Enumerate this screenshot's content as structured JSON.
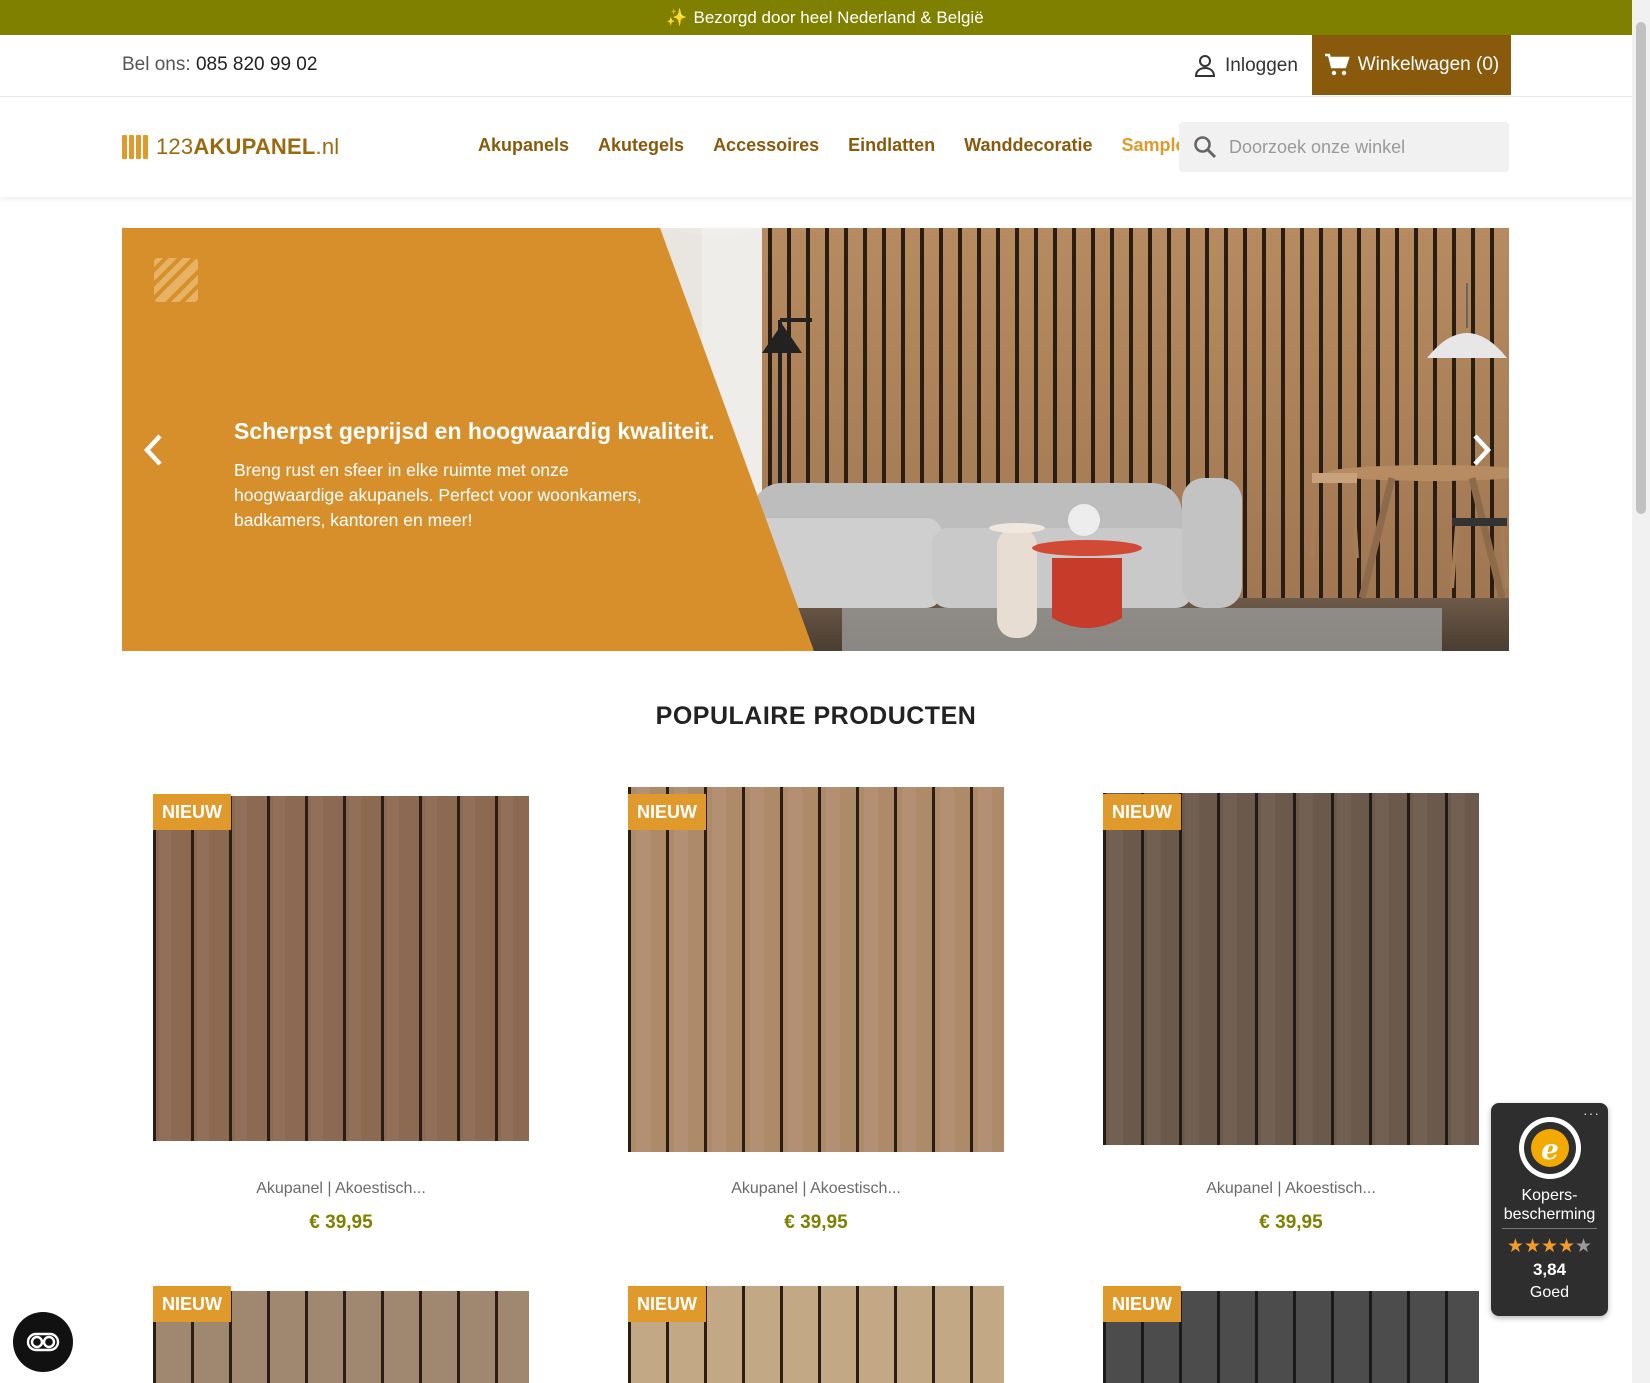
{
  "announcement": {
    "text": "Bezorgd door heel Nederland & België",
    "icon": "sparkles-icon"
  },
  "utility": {
    "phone_label": "Bel ons:",
    "phone_number": "085 820 99 02",
    "login_label": "Inloggen",
    "cart_label": "Winkelwagen (0)"
  },
  "header": {
    "logo_prefix": "123",
    "logo_name": "AKUPANEL",
    "logo_suffix": ".nl",
    "nav": [
      "Akupanels",
      "Akutegels",
      "Accessoires",
      "Eindlatten",
      "Wanddecoratie",
      "Sample kit"
    ],
    "search_placeholder": "Doorzoek onze winkel"
  },
  "hero": {
    "title": "Scherpst geprijsd en hoogwaardig kwaliteit.",
    "text": "Breng rust en sfeer in elke ruimte met onze hoogwaardige akupanels. Perfect voor woonkamers, badkamers, kantoren en meer!"
  },
  "section_title": "POPULAIRE PRODUCTEN",
  "products": [
    {
      "badge": "NIEUW",
      "name": "Akupanel | Akoestisch...",
      "price": "€ 39,95"
    },
    {
      "badge": "NIEUW",
      "name": "Akupanel | Akoestisch...",
      "price": "€ 39,95"
    },
    {
      "badge": "NIEUW",
      "name": "Akupanel | Akoestisch...",
      "price": "€ 39,95"
    },
    {
      "badge": "NIEUW"
    },
    {
      "badge": "NIEUW"
    },
    {
      "badge": "NIEUW"
    }
  ],
  "trust": {
    "label_1": "Kopers-",
    "label_2": "bescherming",
    "score": "3,84",
    "grade": "Goed",
    "rating_stars": 3.84
  },
  "colors": {
    "announcement": "#7f7f00",
    "cart": "#8a5a0c",
    "nav": "#8a5a0c",
    "accent": "#e09a2c",
    "price": "#7f7f00"
  }
}
